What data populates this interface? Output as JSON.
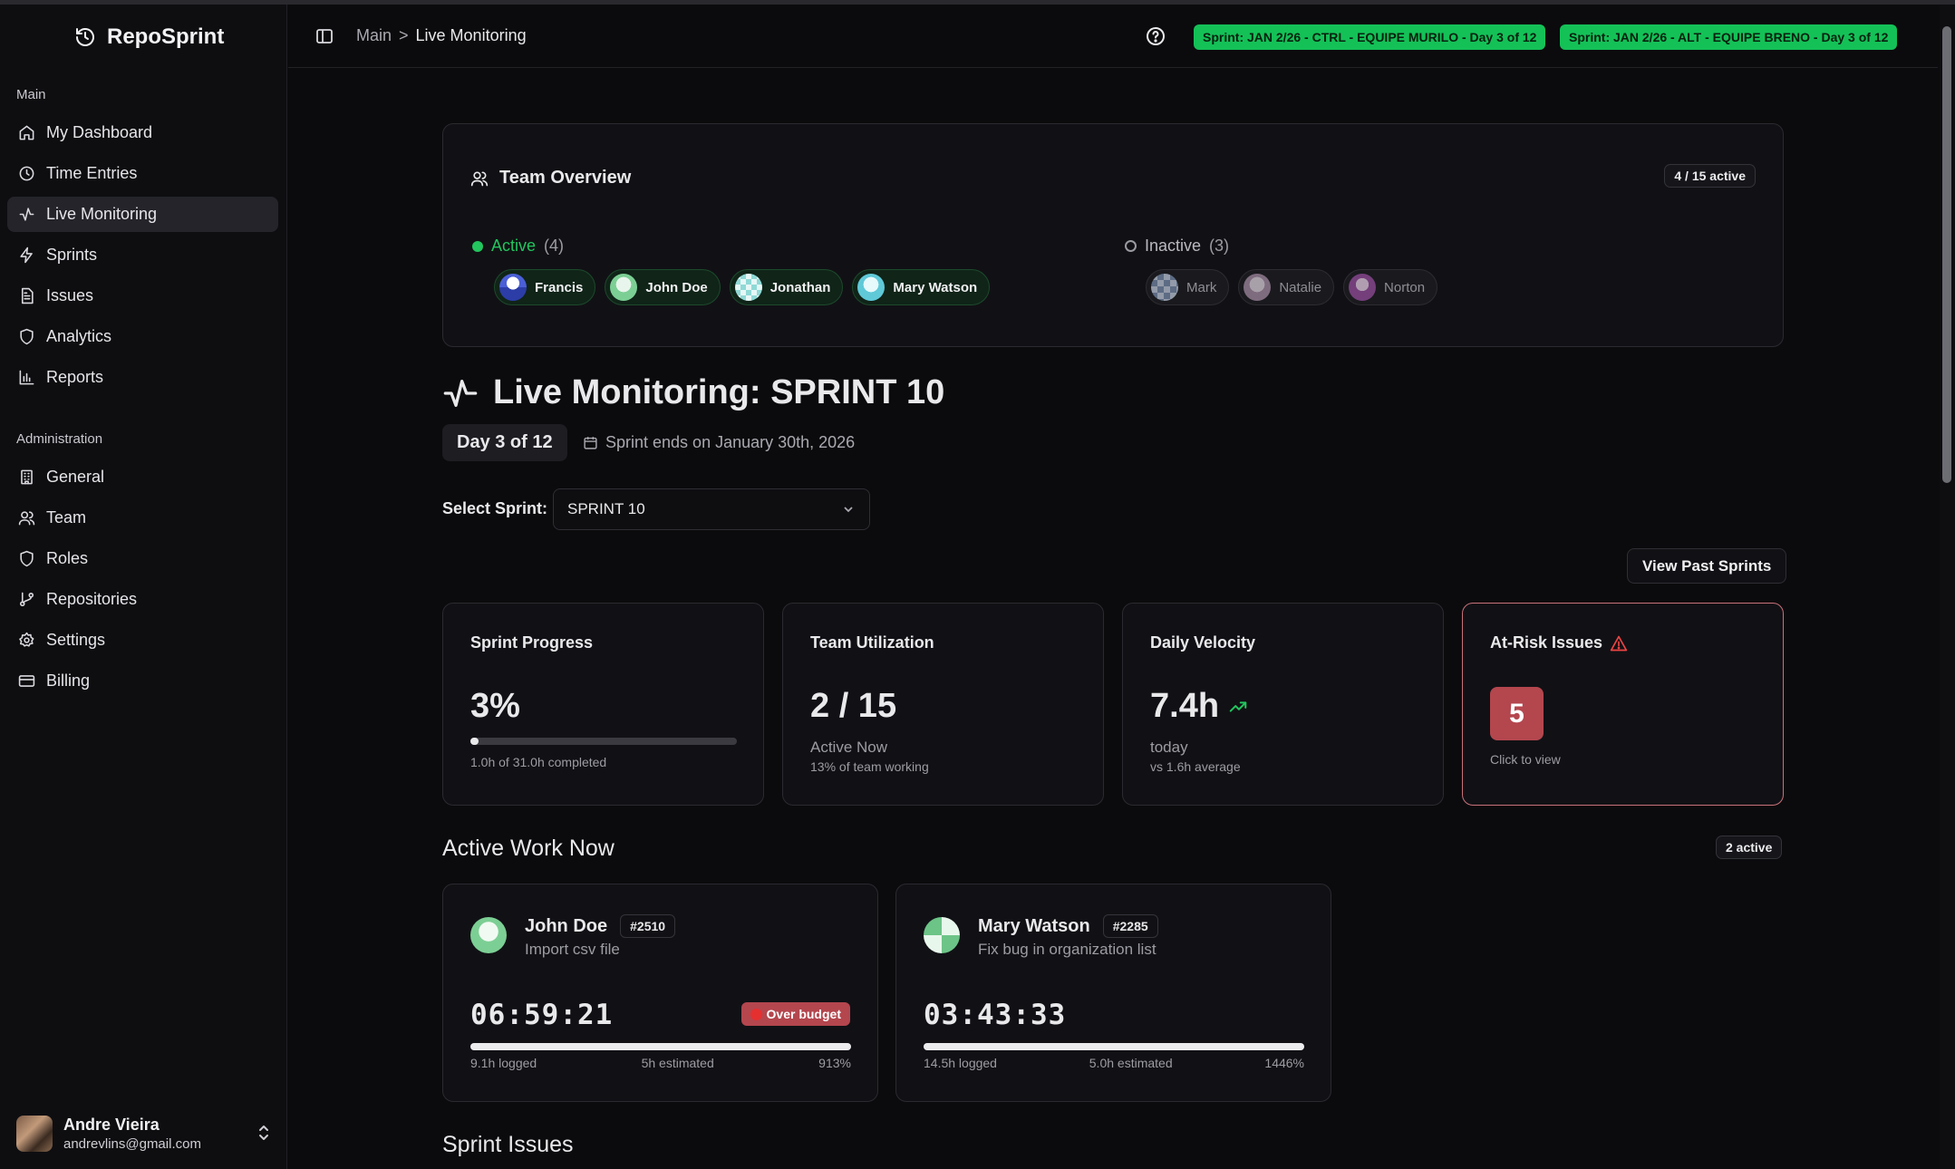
{
  "app": {
    "name": "RepoSprint"
  },
  "sidebar": {
    "main_label": "Main",
    "main_items": [
      {
        "label": "My Dashboard",
        "icon": "home-icon"
      },
      {
        "label": "Time Entries",
        "icon": "clock-icon"
      },
      {
        "label": "Live Monitoring",
        "icon": "activity-icon",
        "active": true
      },
      {
        "label": "Sprints",
        "icon": "zap-icon"
      },
      {
        "label": "Issues",
        "icon": "file-text-icon"
      },
      {
        "label": "Analytics",
        "icon": "shield-icon"
      },
      {
        "label": "Reports",
        "icon": "bar-chart-icon"
      }
    ],
    "admin_label": "Administration",
    "admin_items": [
      {
        "label": "General",
        "icon": "building-icon"
      },
      {
        "label": "Team",
        "icon": "users-icon"
      },
      {
        "label": "Roles",
        "icon": "shield-icon"
      },
      {
        "label": "Repositories",
        "icon": "git-branch-icon"
      },
      {
        "label": "Settings",
        "icon": "gear-icon"
      },
      {
        "label": "Billing",
        "icon": "credit-card-icon"
      }
    ],
    "user": {
      "name": "Andre Vieira",
      "email": "andrevlins@gmail.com"
    }
  },
  "header": {
    "breadcrumb_main": "Main",
    "breadcrumb_sep": ">",
    "breadcrumb_current": "Live Monitoring",
    "sprint_badges": [
      "Sprint: JAN 2/26 - CTRL - EQUIPE MURILO - Day 3 of 12",
      "Sprint: JAN 2/26 - ALT - EQUIPE BRENO - Day 3 of 12"
    ],
    "badge_color": "#14c157"
  },
  "team_overview": {
    "title": "Team Overview",
    "active_count_badge": "4 / 15 active",
    "active_label": "Active",
    "active_count": "(4)",
    "inactive_label": "Inactive",
    "inactive_count": "(3)",
    "active_members": [
      "Francis",
      "John Doe",
      "Jonathan",
      "Mary Watson"
    ],
    "inactive_members": [
      "Mark",
      "Natalie",
      "Norton"
    ]
  },
  "monitoring": {
    "title": "Live Monitoring: SPRINT 10",
    "day_pill": "Day 3 of 12",
    "sprint_ends": "Sprint ends on January 30th, 2026",
    "select_label": "Select Sprint:",
    "select_value": "SPRINT 10",
    "view_past": "View Past Sprints"
  },
  "stats": {
    "progress": {
      "title": "Sprint Progress",
      "value": "3%",
      "fraction": 0.03,
      "sub": "1.0h of 31.0h completed"
    },
    "utilization": {
      "title": "Team Utilization",
      "value": "2 / 15",
      "sub": "Active Now",
      "sub2": "13% of team working"
    },
    "velocity": {
      "title": "Daily Velocity",
      "value": "7.4h",
      "sub": "today",
      "sub2": "vs 1.6h average"
    },
    "risk": {
      "title": "At-Risk Issues",
      "value": "5",
      "sub": "Click to view",
      "color": "#b4464e"
    }
  },
  "active_work": {
    "title": "Active Work Now",
    "badge": "2 active",
    "items": [
      {
        "name": "John Doe",
        "issue": "#2510",
        "desc": "Import csv file",
        "timer": "06:59:21",
        "over_budget": "Over budget",
        "logged": "9.1h logged",
        "estimated": "5h estimated",
        "percent": "913%",
        "fill": 1.0
      },
      {
        "name": "Mary Watson",
        "issue": "#2285",
        "desc": "Fix bug in organization list",
        "timer": "03:43:33",
        "logged": "14.5h logged",
        "estimated": "5.0h estimated",
        "percent": "1446%",
        "fill": 1.0
      }
    ]
  },
  "sprint_issues": {
    "title": "Sprint Issues"
  }
}
